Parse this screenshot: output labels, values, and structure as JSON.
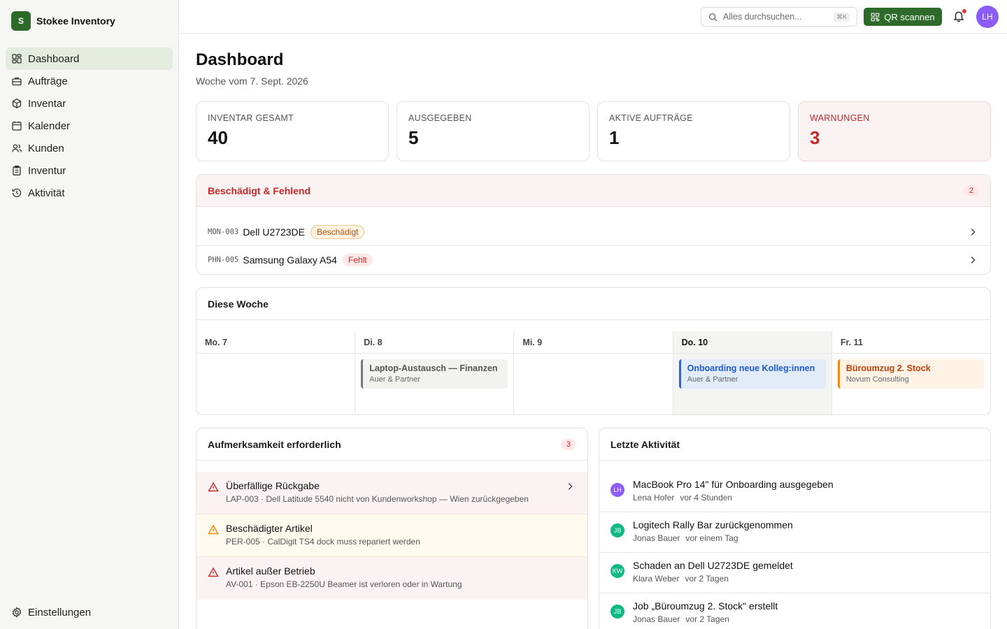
{
  "brand": {
    "logo": "S",
    "name": "Stokee Inventory"
  },
  "sidebar": {
    "items": [
      {
        "label": "Dashboard",
        "icon": "dashboard-icon",
        "active": true
      },
      {
        "label": "Aufträge",
        "icon": "briefcase-icon"
      },
      {
        "label": "Inventar",
        "icon": "box-icon"
      },
      {
        "label": "Kalender",
        "icon": "calendar-icon"
      },
      {
        "label": "Kunden",
        "icon": "users-icon"
      },
      {
        "label": "Inventur",
        "icon": "clipboard-icon"
      },
      {
        "label": "Aktivität",
        "icon": "history-icon"
      }
    ],
    "settings": {
      "label": "Einstellungen",
      "icon": "gear-icon"
    }
  },
  "topbar": {
    "search_placeholder": "Alles durchsuchen...",
    "search_shortcut": "⌘K",
    "qr_label": "QR scannen",
    "avatar": "LH",
    "avatar_color": "#8b5cf6"
  },
  "page": {
    "title": "Dashboard",
    "subtitle": "Woche vom 7. Sept. 2026"
  },
  "stats": [
    {
      "label": "INVENTAR GESAMT",
      "value": "40"
    },
    {
      "label": "AUSGEGEBEN",
      "value": "5"
    },
    {
      "label": "AKTIVE AUFTRÄGE",
      "value": "1"
    },
    {
      "label": "WARNUNGEN",
      "value": "3",
      "warn": true
    }
  ],
  "damaged": {
    "title": "Beschädigt & Fehlend",
    "count": "2",
    "items": [
      {
        "code": "MON-003",
        "name": "Dell U2723DE",
        "status": "Beschädigt"
      },
      {
        "code": "PHN-005",
        "name": "Samsung Galaxy A54",
        "status": "Fehlt"
      }
    ]
  },
  "week": {
    "title": "Diese Woche",
    "days": [
      {
        "label": "Mo. 7"
      },
      {
        "label": "Di. 8",
        "event": {
          "title": "Laptop-Austausch — Finanzen",
          "client": "Auer & Partner"
        }
      },
      {
        "label": "Mi. 9"
      },
      {
        "label": "Do. 10",
        "today": true,
        "event": {
          "title": "Onboarding neue Kolleg:innen",
          "client": "Auer & Partner"
        }
      },
      {
        "label": "Fr. 11",
        "event": {
          "title": "Büroumzug 2. Stock",
          "client": "Novum Consulting"
        }
      }
    ]
  },
  "attention": {
    "title": "Aufmerksamkeit erforderlich",
    "count": "3",
    "items": [
      {
        "title": "Überfällige Rückgabe",
        "detail": "LAP-003 · Dell Latitude 5540 nicht von Kundenworkshop — Wien zurückgegeben",
        "severity": "red"
      },
      {
        "title": "Beschädigter Artikel",
        "detail": "PER-005 · CalDigit TS4 dock muss repariert werden",
        "severity": "amber"
      },
      {
        "title": "Artikel außer Betrieb",
        "detail": "AV-001 · Epson EB-2250U Beamer ist verloren oder in Wartung",
        "severity": "red"
      }
    ]
  },
  "activity": {
    "title": "Letzte Aktivität",
    "items": [
      {
        "initials": "LH",
        "color": "#8b5cf6",
        "title": "MacBook Pro 14\" für Onboarding ausgegeben",
        "user": "Lena Hofer",
        "time": "vor 4 Stunden"
      },
      {
        "initials": "JB",
        "color": "#10b981",
        "title": "Logitech Rally Bar zurückgenommen",
        "user": "Jonas Bauer",
        "time": "vor einem Tag"
      },
      {
        "initials": "KW",
        "color": "#10b981",
        "title": "Schaden an Dell U2723DE gemeldet",
        "user": "Klara Weber",
        "time": "vor 2 Tagen"
      },
      {
        "initials": "JB",
        "color": "#10b981",
        "title": "Job „Büroumzug 2. Stock\" erstellt",
        "user": "Jonas Bauer",
        "time": "vor 2 Tagen"
      }
    ]
  }
}
